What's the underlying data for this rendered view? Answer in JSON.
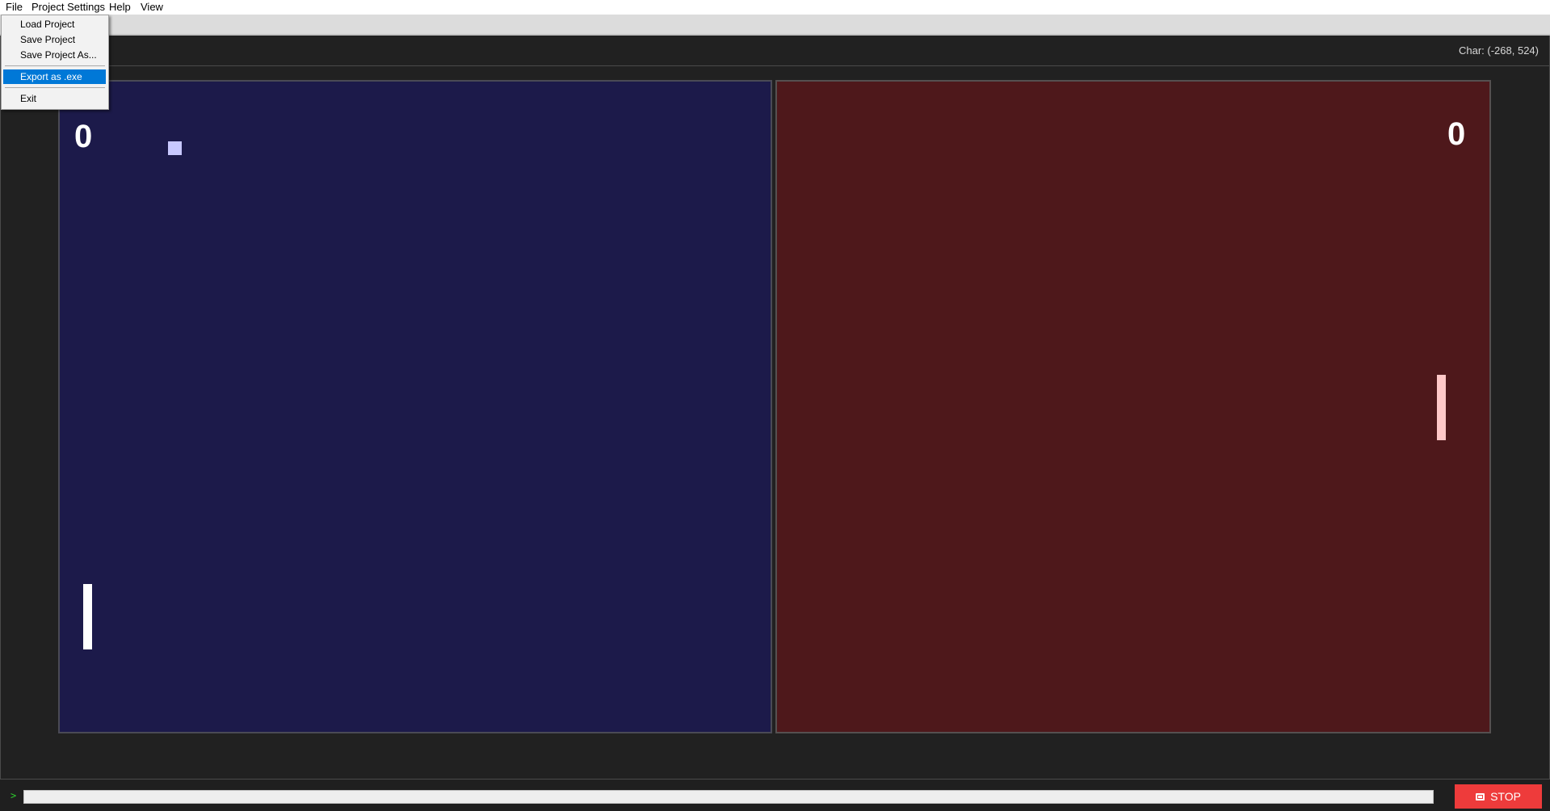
{
  "menubar": {
    "items": [
      "File",
      "Project Settings",
      "Help",
      "View"
    ]
  },
  "file_menu": {
    "load_project": "Load Project",
    "save_project": "Save Project",
    "save_project_as": "Save Project As...",
    "export_exe": "Export as .exe",
    "exit": "Exit"
  },
  "status": {
    "char_readout": "Char: (-268, 524)"
  },
  "game": {
    "score_left": "0",
    "score_right": "0",
    "colors": {
      "left_court": "#1c1a4a",
      "right_court": "#4e181b",
      "ball": "#c8c8ff",
      "left_paddle": "#ffffff",
      "right_paddle": "#ffc8c8"
    }
  },
  "console": {
    "prompt": ">",
    "input_value": "",
    "stop_label": "STOP"
  },
  "colors": {
    "accent_highlight": "#0078d7",
    "stop_button": "#ee3b3b"
  }
}
